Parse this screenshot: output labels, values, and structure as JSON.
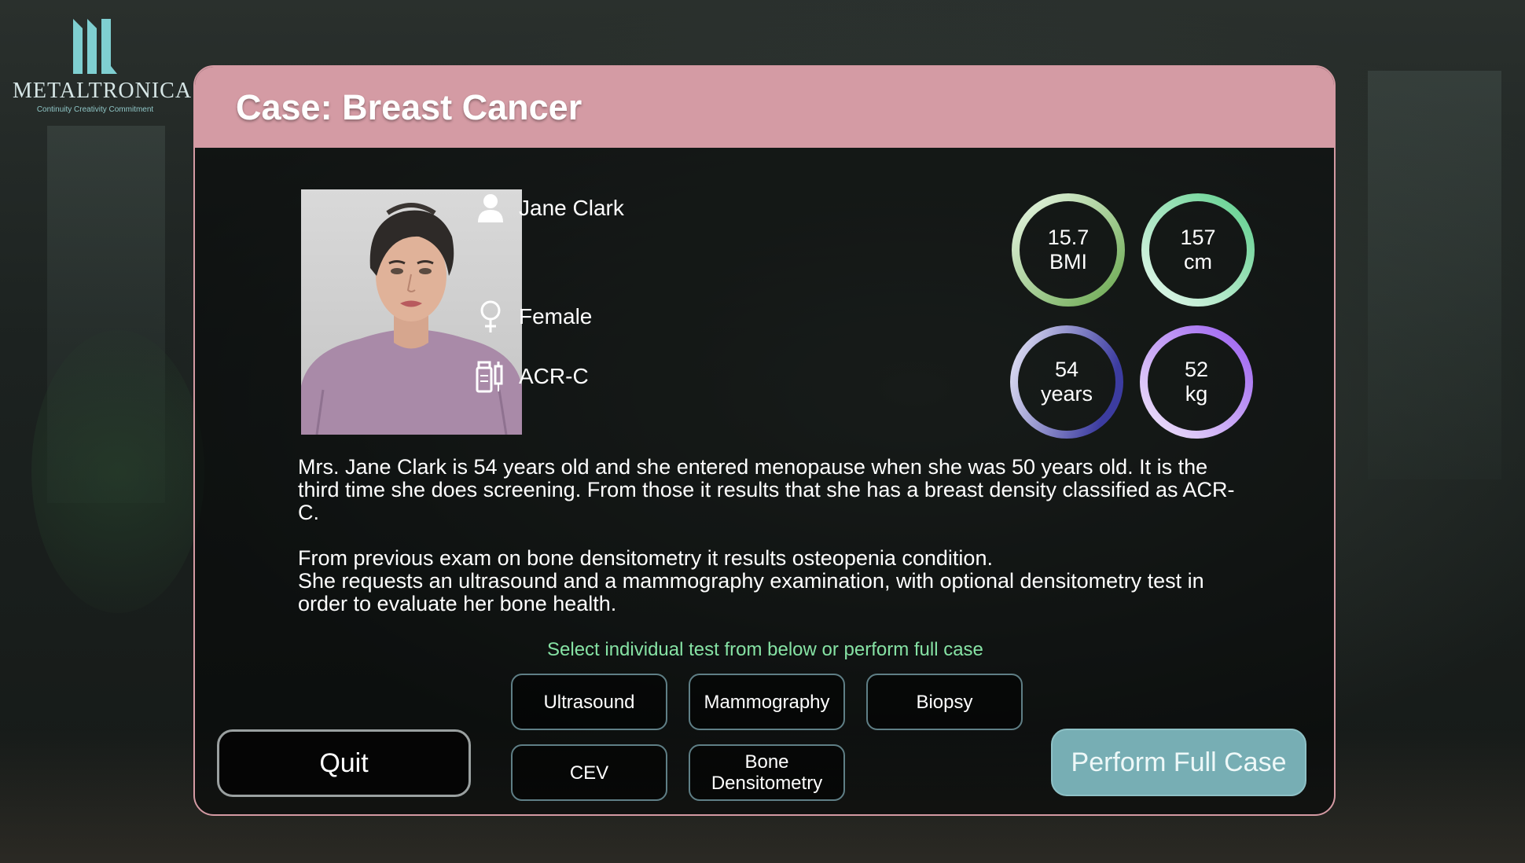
{
  "brand": {
    "name": "METALTRONICA",
    "tagline": "Continuity Creativity Commitment"
  },
  "case": {
    "title": "Case: Breast Cancer"
  },
  "patient": {
    "name": "Jane Clark",
    "sex": "Female",
    "density": "ACR-C",
    "portrait_icon": "patient-avatar"
  },
  "metrics": [
    {
      "value": "15.7",
      "unit": "BMI",
      "color": "#7fc26d"
    },
    {
      "value": "157",
      "unit": "cm",
      "color": "#6fcf97"
    },
    {
      "value": "54",
      "unit": "years",
      "color": "#4b4bb0"
    },
    {
      "value": "52",
      "unit": "kg",
      "color": "#a86ef0"
    }
  ],
  "description": {
    "paragraph1": "Mrs. Jane Clark is 54 years old and she entered menopause when she was 50 years old. It is the third time she does screening. From those it results that she has a breast density classified as ACR-C.",
    "paragraph2_line1": "From previous exam on bone densitometry it results osteopenia condition.",
    "paragraph2_line2": "She requests an ultrasound and a mammography examination, with optional densitometry test in order to evaluate her bone health."
  },
  "hint": "Select individual test from below or perform full case",
  "tests": {
    "ultrasound": "Ultrasound",
    "mammography": "Mammography",
    "biopsy": "Biopsy",
    "cev": "CEV",
    "bone_line1": "Bone",
    "bone_line2": "Densitometry"
  },
  "actions": {
    "quit": "Quit",
    "full_case": "Perform Full Case"
  },
  "colors": {
    "header": "#d49ba4",
    "accent_button": "#77aeb4",
    "hint": "#86e2a4"
  }
}
